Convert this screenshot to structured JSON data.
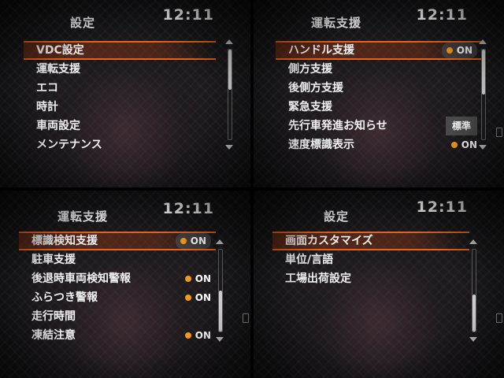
{
  "panels": [
    {
      "title": "設定",
      "clock": "12:11",
      "items": [
        {
          "label": "VDC設定",
          "selected": true
        },
        {
          "label": "運転支援"
        },
        {
          "label": "エコ"
        },
        {
          "label": "時計"
        },
        {
          "label": "車両設定"
        },
        {
          "label": "メンテナンス"
        }
      ],
      "scroll_position": 0.0,
      "scroll_size": 0.45
    },
    {
      "title": "運転支援",
      "clock": "12:11",
      "items": [
        {
          "label": "ハンドル支援",
          "selected": true,
          "value": "ON",
          "indicator": "on"
        },
        {
          "label": "側方支援"
        },
        {
          "label": "後側方支援"
        },
        {
          "label": "緊急支援"
        },
        {
          "label": "先行車発進お知らせ",
          "value": "標準"
        },
        {
          "label": "速度標識表示",
          "value": "ON",
          "indicator": "on"
        }
      ],
      "scroll_position": 0.0,
      "scroll_size": 0.5
    },
    {
      "title": "運転支援",
      "clock": "12:11",
      "items": [
        {
          "label": "標識検知支援",
          "selected": true,
          "value": "ON",
          "indicator": "on"
        },
        {
          "label": "駐車支援"
        },
        {
          "label": "後退時車両検知警報",
          "value": "ON",
          "indicator": "on"
        },
        {
          "label": "ふらつき警報",
          "value": "ON",
          "indicator": "on"
        },
        {
          "label": "走行時間"
        },
        {
          "label": "凍結注意",
          "value": "ON",
          "indicator": "on"
        }
      ],
      "scroll_position": 0.5,
      "scroll_size": 0.5
    },
    {
      "title": "設定",
      "clock": "12:11",
      "items": [
        {
          "label": "画面カスタマイズ",
          "selected": true
        },
        {
          "label": "単位/言語"
        },
        {
          "label": "工場出荷設定"
        }
      ],
      "scroll_position": 0.55,
      "scroll_size": 0.45
    }
  ],
  "colors": {
    "accent": "#e8621e",
    "indicator_on": "#f39a1a",
    "text": "#f2f2f2"
  },
  "icons": {
    "scroll_up": "triangle-up-icon",
    "scroll_down": "triangle-down-icon",
    "status_dot": "orange-dot-icon"
  }
}
